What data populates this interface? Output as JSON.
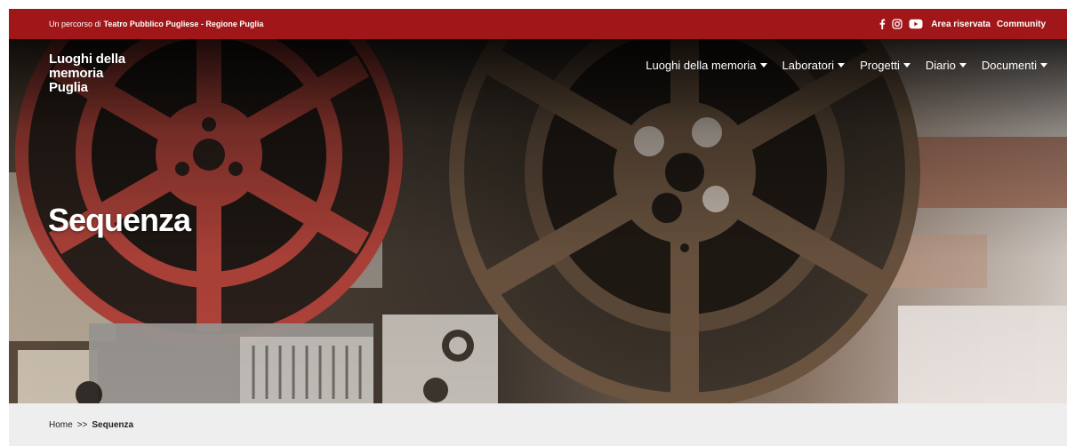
{
  "topbar": {
    "prefix": "Un percorso di",
    "org": "Teatro Pubblico Pugliese - Regione Puglia",
    "links": [
      "Area riservata",
      "Community"
    ],
    "social_icons": [
      "facebook-icon",
      "instagram-icon",
      "youtube-icon"
    ]
  },
  "logo": {
    "lines": [
      "Luoghi della",
      "memoria",
      "Puglia"
    ]
  },
  "nav": {
    "items": [
      {
        "label": "Luoghi della memoria"
      },
      {
        "label": "Laboratori"
      },
      {
        "label": "Progetti"
      },
      {
        "label": "Diario"
      },
      {
        "label": "Documenti"
      }
    ]
  },
  "hero": {
    "title": "Sequenza"
  },
  "breadcrumb": {
    "home": "Home",
    "separator": ">>",
    "current": "Sequenza"
  },
  "colors": {
    "topbar": "#a11618",
    "reel_red": "#b0433a",
    "reel_brown": "#6b5440",
    "breadcrumb_bg": "#eeeeee"
  }
}
